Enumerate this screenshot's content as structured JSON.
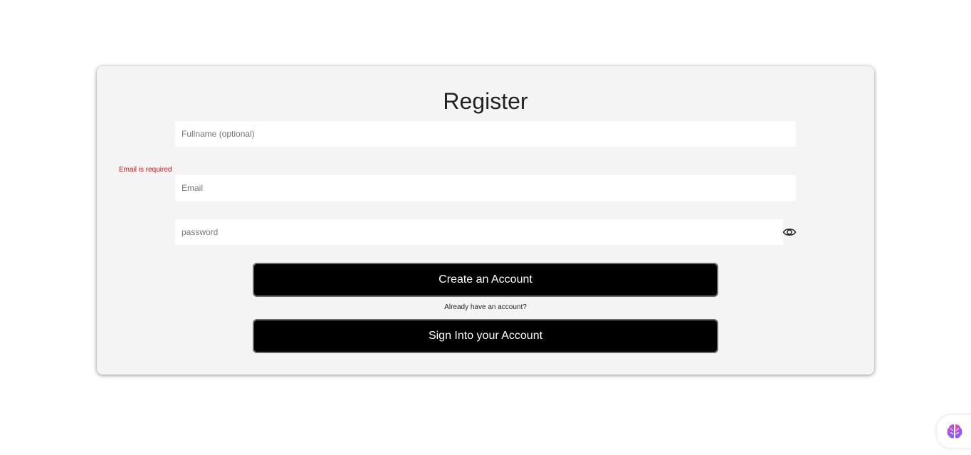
{
  "form": {
    "title": "Register",
    "fullname_placeholder": "Fullname (optional)",
    "email_error": "Email is required",
    "email_placeholder": "Email",
    "password_placeholder": "password",
    "create_button_label": "Create an Account",
    "already_text": "Already have an account?",
    "signin_button_label": "Sign Into your Account"
  },
  "icons": {
    "password_toggle": "eye-icon",
    "widget": "brain-icon"
  },
  "colors": {
    "card_background": "#f4f4f4",
    "button_background": "#000000",
    "error_text": "#d01010"
  }
}
